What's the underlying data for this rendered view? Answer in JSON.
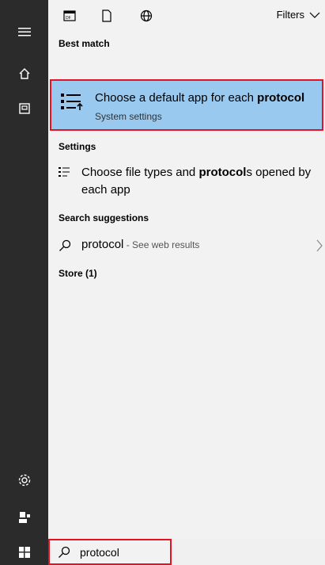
{
  "rail": {
    "icons": [
      "hamburger-icon",
      "home-icon",
      "document-icon",
      "settings-icon",
      "user-icon"
    ]
  },
  "topbar": {
    "icons": [
      "apps-icon",
      "document-icon",
      "globe-icon"
    ],
    "filters_label": "Filters"
  },
  "best_match": {
    "heading": "Best match",
    "title_pre": "Choose a default app for each ",
    "title_bold": "protocol",
    "subtitle": "System settings",
    "icon": "default-apps-icon"
  },
  "settings": {
    "heading": "Settings",
    "item": {
      "pre": "Choose file types and ",
      "bold": "protocol",
      "post": "s opened by",
      "line2": "each app",
      "icon": "list-icon"
    }
  },
  "search_suggestions": {
    "heading": "Search suggestions",
    "item": {
      "query": "protocol",
      "suffix": " - See web results",
      "icon": "search-icon"
    }
  },
  "store": {
    "heading": "Store (1)"
  },
  "taskbar": {
    "search_value": "protocol",
    "start_icon": "windows-icon"
  }
}
